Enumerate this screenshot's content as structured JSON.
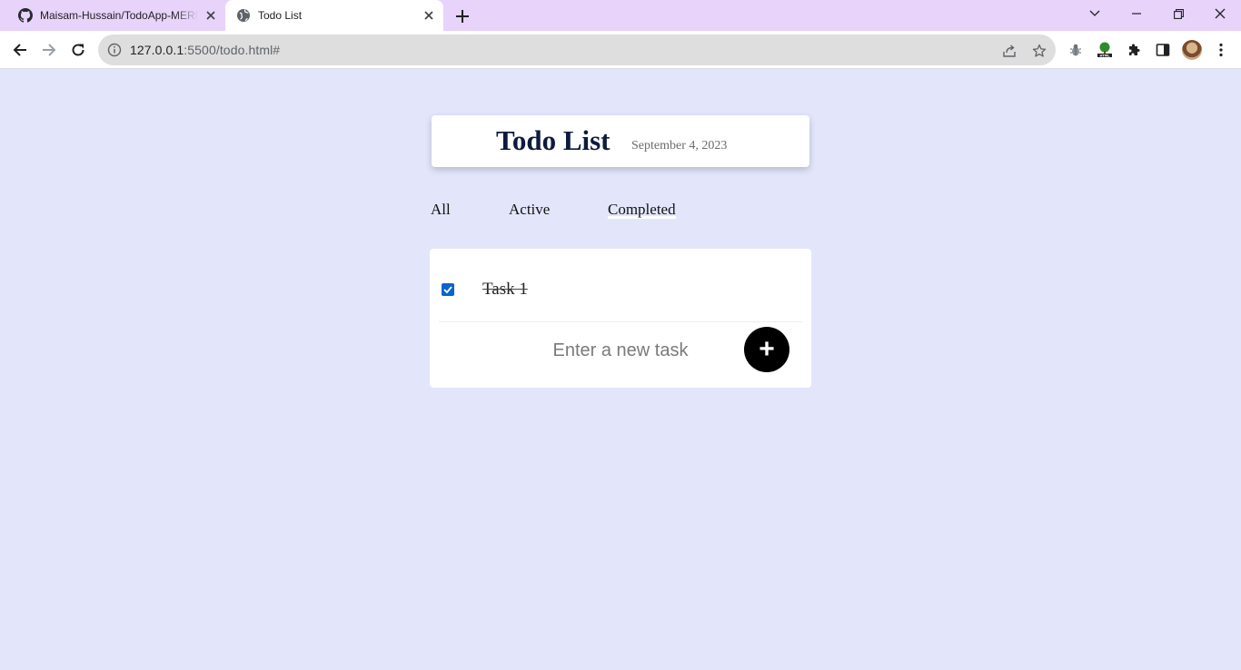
{
  "browser": {
    "tabs": [
      {
        "title": "Maisam-Hussain/TodoApp-MERN",
        "icon": "github-icon",
        "active": false
      },
      {
        "title": "Todo List",
        "icon": "globe-icon",
        "active": true
      }
    ],
    "address": {
      "host": "127.0.0.1",
      "rest": ":5500/todo.html#"
    }
  },
  "page": {
    "title": "Todo List",
    "date": "September 4, 2023",
    "filters": [
      {
        "label": "All",
        "active": false
      },
      {
        "label": "Active",
        "active": false
      },
      {
        "label": "Completed",
        "active": true
      }
    ],
    "tasks": [
      {
        "label": "Task 1",
        "completed": true
      }
    ],
    "new_task": {
      "placeholder": "Enter a new task",
      "value": ""
    },
    "add_button_label": "+"
  },
  "colors": {
    "page_background": "#e3e6fb",
    "tabstrip": "#e8d3fb",
    "title_text": "#0d1b3e",
    "checkbox": "#0b63ce",
    "add_button": "#000000"
  }
}
